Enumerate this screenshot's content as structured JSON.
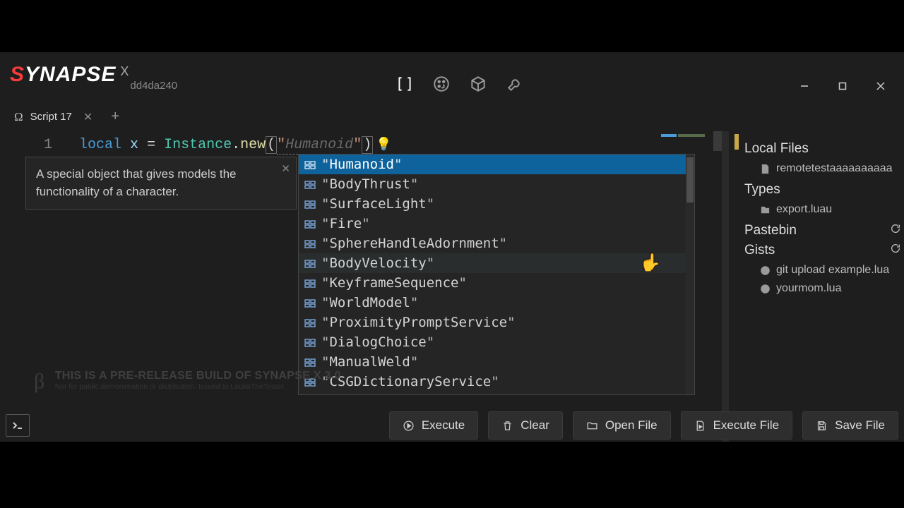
{
  "brand": {
    "name_a": "S",
    "name_b": "YNAPSE",
    "x": "X",
    "hash": "dd4da240"
  },
  "tabs": [
    {
      "label": "Script 17"
    }
  ],
  "editor": {
    "line_no": "1",
    "kw_local": "local",
    "var": "x",
    "op": "=",
    "class": "Instance",
    "dot": ".",
    "fn": "new",
    "lparen": "(",
    "quote": "\"",
    "hint": "Humanoid",
    "rparen": ")"
  },
  "tooltip": {
    "text": "A special object that gives models the functionality of a character."
  },
  "suggest": {
    "items": [
      "Humanoid",
      "BodyThrust",
      "SurfaceLight",
      "Fire",
      "SphereHandleAdornment",
      "BodyVelocity",
      "KeyframeSequence",
      "WorldModel",
      "ProximityPromptService",
      "DialogChoice",
      "ManualWeld",
      "CSGDictionaryService"
    ]
  },
  "watermark": {
    "beta": "β",
    "line1": "THIS IS A PRE-RELEASE BUILD OF SYNAPSE X 3.0",
    "line2": "Not for public demonstration or distribution. Issued to LoukaTheTester."
  },
  "sidebar": {
    "local_h": "Local Files",
    "local_items": [
      "remotetestaaaaaaaaaa"
    ],
    "types_h": "Types",
    "types_items": [
      "export.luau"
    ],
    "pastebin_h": "Pastebin",
    "gists_h": "Gists",
    "gists_items": [
      "git upload example.lua",
      "yourmom.lua"
    ]
  },
  "buttons": {
    "execute": "Execute",
    "clear": "Clear",
    "open": "Open File",
    "exec_file": "Execute File",
    "save": "Save File"
  }
}
